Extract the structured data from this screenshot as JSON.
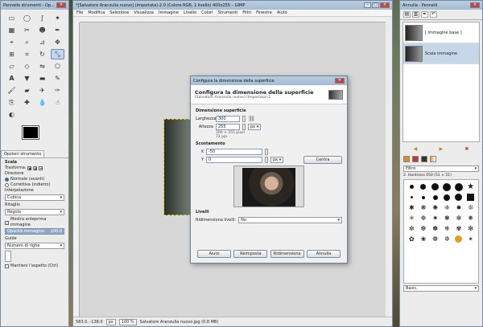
{
  "toolbox": {
    "title": "Pannello strumenti - Op...",
    "tab_label": "Opzioni strumento",
    "tool_name": "Scala",
    "transform_label": "Trasforma:",
    "direction_label": "Direzione",
    "dir_normal": "Normale (avanti)",
    "dir_corrective": "Correttiva (indietro)",
    "interp_label": "Interpolazione",
    "interp_value": "Cubica",
    "clip_label": "Ritaglio",
    "clip_value": "Regola",
    "preview_label": "Mostra anteprima immagine",
    "opacity_label": "Opacità immagine",
    "opacity_value": "100.0",
    "guides_label": "Guide",
    "guides_value": "Numero di righe",
    "keep_label": "Mantieni l'aspetto  (Ctrl)"
  },
  "main": {
    "title": "*[Salvatore Aranzulla nuovo] (importata)-2.0 (Colore RGB, 1 livello) 400x255 – GIMP",
    "menu": [
      "File",
      "Modifica",
      "Selezione",
      "Visualizza",
      "Immagine",
      "Livello",
      "Colori",
      "Strumenti",
      "Filtri",
      "Finestre",
      "Aiuto"
    ],
    "status": {
      "coords": "583.0, -138.0",
      "unit": "px",
      "zoom": "100 %",
      "info": "Salvatore Aranzulla nuovo.jpg (0.8 MB)"
    }
  },
  "dialog": {
    "window_title": "Configura la dimensione della superficie",
    "heading": "Configura la dimensione della superficie",
    "subheading": "[Salvatore Aranzulla nuovo] (Importata)-2",
    "size_section": "Dimensione superficie",
    "width_label": "Larghezza",
    "width_value": "300",
    "height_label": "Altezza",
    "height_value": "255",
    "unit": "px",
    "size_info": "300 × 255 pixel",
    "res_info": "72 ppi",
    "offset_section": "Scostamento",
    "x_label": "X",
    "x_value": "-50",
    "y_label": "Y",
    "y_value": "0",
    "offset_unit": "px",
    "center_button": "Centra",
    "layers_section": "Livelli",
    "resize_layers_label": "Ridimensiona livelli:",
    "resize_layers_value": "No",
    "buttons": [
      "Aiuto",
      "Reimposta",
      "Ridimensiona",
      "Annulla"
    ]
  },
  "dock": {
    "title": "Annulla - Pennelli",
    "history": [
      "[ Immagine base ]",
      "Scala immagine"
    ],
    "brush_filter": "Filtro",
    "brush_name": "2. Hardness 050 (51 × 51)",
    "brush_tag": "Basic,"
  }
}
